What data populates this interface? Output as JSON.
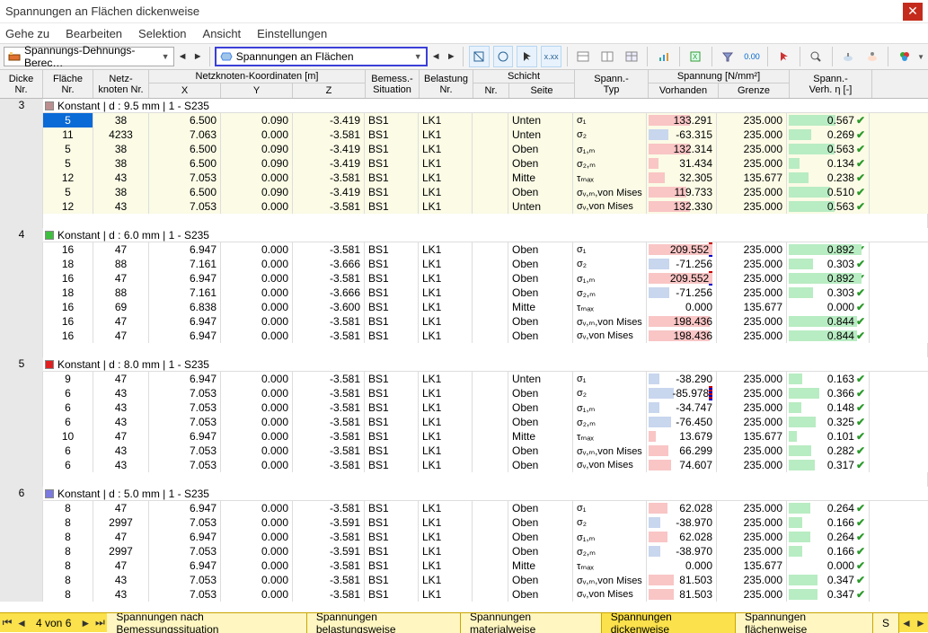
{
  "window": {
    "title": "Spannungen an Flächen dickenweise"
  },
  "menu": [
    "Gehe zu",
    "Bearbeiten",
    "Selektion",
    "Ansicht",
    "Einstellungen"
  ],
  "toolbar": {
    "left_dropdown": "Spannungs-Dehnungs-Berec…",
    "main_dropdown": "Spannungen an Flächen"
  },
  "columns": {
    "dicke": "Dicke\nNr.",
    "flaeche": "Fläche\nNr.",
    "netzknoten": "Netz-\nknoten Nr.",
    "koord_group": "Netzknoten-Koordinaten [m]",
    "x": "X",
    "y": "Y",
    "z": "Z",
    "bemess": "Bemess.-\nSituation",
    "belastung": "Belastung\nNr.",
    "schicht_group": "Schicht",
    "schicht_nr": "Nr.",
    "seite": "Seite",
    "spanntyp": "Spann.-\nTyp",
    "spannung_group": "Spannung [N/mm²]",
    "vorhanden": "Vorhanden",
    "grenze": "Grenze",
    "spannverh": "Spann.-\nVerh. η [-]"
  },
  "groups": [
    {
      "dicke": "3",
      "swatch": "#bb8f8f",
      "label": "Konstant | d : 9.5 mm | 1 - S235",
      "shade": "pale",
      "rows": [
        {
          "fl": "5",
          "sel": true,
          "nk": "38",
          "x": "6.500",
          "y": "0.090",
          "z": "-3.419",
          "bs": "BS1",
          "bl": "LK1",
          "sn": "",
          "st": "Unten",
          "typ": "σ₁",
          "vor": "133.291",
          "vorbar": 60,
          "vorcolor": "red",
          "gr": "235.000",
          "vh": "0.567"
        },
        {
          "fl": "11",
          "nk": "4233",
          "x": "7.063",
          "y": "0.000",
          "z": "-3.581",
          "bs": "BS1",
          "bl": "LK1",
          "sn": "",
          "st": "Unten",
          "typ": "σ₂",
          "vor": "-63.315",
          "vorbar": 28,
          "vorcolor": "blue",
          "gr": "235.000",
          "vh": "0.269"
        },
        {
          "fl": "5",
          "nk": "38",
          "x": "6.500",
          "y": "0.090",
          "z": "-3.419",
          "bs": "BS1",
          "bl": "LK1",
          "sn": "",
          "st": "Oben",
          "typ": "σ₁,ₘ",
          "vor": "132.314",
          "vorbar": 60,
          "vorcolor": "red",
          "gr": "235.000",
          "vh": "0.563"
        },
        {
          "fl": "5",
          "nk": "38",
          "x": "6.500",
          "y": "0.090",
          "z": "-3.419",
          "bs": "BS1",
          "bl": "LK1",
          "sn": "",
          "st": "Oben",
          "typ": "σ₂,ₘ",
          "vor": "31.434",
          "vorbar": 14,
          "vorcolor": "red",
          "gr": "235.000",
          "vh": "0.134"
        },
        {
          "fl": "12",
          "nk": "43",
          "x": "7.053",
          "y": "0.000",
          "z": "-3.581",
          "bs": "BS1",
          "bl": "LK1",
          "sn": "",
          "st": "Mitte",
          "typ": "τₘₐₓ",
          "vor": "32.305",
          "vorbar": 24,
          "vorcolor": "red",
          "gr": "135.677",
          "vh": "0.238"
        },
        {
          "fl": "5",
          "nk": "38",
          "x": "6.500",
          "y": "0.090",
          "z": "-3.419",
          "bs": "BS1",
          "bl": "LK1",
          "sn": "",
          "st": "Oben",
          "typ": "σᵥ,ₘ,von Mises",
          "vor": "119.733",
          "vorbar": 54,
          "vorcolor": "red",
          "gr": "235.000",
          "vh": "0.510"
        },
        {
          "fl": "12",
          "nk": "43",
          "x": "7.053",
          "y": "0.000",
          "z": "-3.581",
          "bs": "BS1",
          "bl": "LK1",
          "sn": "",
          "st": "Unten",
          "typ": "σᵥ,von Mises",
          "vor": "132.330",
          "vorbar": 60,
          "vorcolor": "red",
          "gr": "235.000",
          "vh": "0.563"
        }
      ]
    },
    {
      "dicke": "4",
      "swatch": "#3fbf3f",
      "label": "Konstant | d : 6.0 mm | 1 - S235",
      "shade": "",
      "rows": [
        {
          "fl": "16",
          "nk": "47",
          "x": "6.947",
          "y": "0.000",
          "z": "-3.581",
          "bs": "BS1",
          "bl": "LK1",
          "sn": "",
          "st": "Oben",
          "typ": "σ₁",
          "vor": "209.552",
          "vorbar": 92,
          "vorcolor": "red",
          "mark": true,
          "gr": "235.000",
          "vh": "0.892"
        },
        {
          "fl": "18",
          "nk": "88",
          "x": "7.161",
          "y": "0.000",
          "z": "-3.666",
          "bs": "BS1",
          "bl": "LK1",
          "sn": "",
          "st": "Oben",
          "typ": "σ₂",
          "vor": "-71.256",
          "vorbar": 30,
          "vorcolor": "blue",
          "gr": "235.000",
          "vh": "0.303"
        },
        {
          "fl": "16",
          "nk": "47",
          "x": "6.947",
          "y": "0.000",
          "z": "-3.581",
          "bs": "BS1",
          "bl": "LK1",
          "sn": "",
          "st": "Oben",
          "typ": "σ₁,ₘ",
          "vor": "209.552",
          "vorbar": 92,
          "vorcolor": "red",
          "mark": true,
          "gr": "235.000",
          "vh": "0.892"
        },
        {
          "fl": "18",
          "nk": "88",
          "x": "7.161",
          "y": "0.000",
          "z": "-3.666",
          "bs": "BS1",
          "bl": "LK1",
          "sn": "",
          "st": "Oben",
          "typ": "σ₂,ₘ",
          "vor": "-71.256",
          "vorbar": 30,
          "vorcolor": "blue",
          "gr": "235.000",
          "vh": "0.303"
        },
        {
          "fl": "16",
          "nk": "69",
          "x": "6.838",
          "y": "0.000",
          "z": "-3.600",
          "bs": "BS1",
          "bl": "LK1",
          "sn": "",
          "st": "Mitte",
          "typ": "τₘₐₓ",
          "vor": "0.000",
          "vorbar": 0,
          "vorcolor": "red",
          "gr": "135.677",
          "vh": "0.000"
        },
        {
          "fl": "16",
          "nk": "47",
          "x": "6.947",
          "y": "0.000",
          "z": "-3.581",
          "bs": "BS1",
          "bl": "LK1",
          "sn": "",
          "st": "Oben",
          "typ": "σᵥ,ₘ,von Mises",
          "vor": "198.436",
          "vorbar": 88,
          "vorcolor": "red",
          "gr": "235.000",
          "vh": "0.844"
        },
        {
          "fl": "16",
          "nk": "47",
          "x": "6.947",
          "y": "0.000",
          "z": "-3.581",
          "bs": "BS1",
          "bl": "LK1",
          "sn": "",
          "st": "Oben",
          "typ": "σᵥ,von Mises",
          "vor": "198.436",
          "vorbar": 88,
          "vorcolor": "red",
          "gr": "235.000",
          "vh": "0.844"
        }
      ]
    },
    {
      "dicke": "5",
      "swatch": "#e02020",
      "label": "Konstant | d : 8.0 mm | 1 - S235",
      "shade": "",
      "rows": [
        {
          "fl": "9",
          "nk": "47",
          "x": "6.947",
          "y": "0.000",
          "z": "-3.581",
          "bs": "BS1",
          "bl": "LK1",
          "sn": "",
          "st": "Unten",
          "typ": "σ₁",
          "vor": "-38.290",
          "vorbar": 16,
          "vorcolor": "blue",
          "gr": "235.000",
          "vh": "0.163"
        },
        {
          "fl": "6",
          "nk": "43",
          "x": "7.053",
          "y": "0.000",
          "z": "-3.581",
          "bs": "BS1",
          "bl": "LK1",
          "sn": "",
          "st": "Oben",
          "typ": "σ₂",
          "vor": "-85.978",
          "vorbar": 37,
          "vorcolor": "blue",
          "mark": true,
          "gr": "235.000",
          "vh": "0.366"
        },
        {
          "fl": "6",
          "nk": "43",
          "x": "7.053",
          "y": "0.000",
          "z": "-3.581",
          "bs": "BS1",
          "bl": "LK1",
          "sn": "",
          "st": "Oben",
          "typ": "σ₁,ₘ",
          "vor": "-34.747",
          "vorbar": 15,
          "vorcolor": "blue",
          "gr": "235.000",
          "vh": "0.148"
        },
        {
          "fl": "6",
          "nk": "43",
          "x": "7.053",
          "y": "0.000",
          "z": "-3.581",
          "bs": "BS1",
          "bl": "LK1",
          "sn": "",
          "st": "Oben",
          "typ": "σ₂,ₘ",
          "vor": "-76.450",
          "vorbar": 33,
          "vorcolor": "blue",
          "gr": "235.000",
          "vh": "0.325"
        },
        {
          "fl": "10",
          "nk": "47",
          "x": "6.947",
          "y": "0.000",
          "z": "-3.581",
          "bs": "BS1",
          "bl": "LK1",
          "sn": "",
          "st": "Mitte",
          "typ": "τₘₐₓ",
          "vor": "13.679",
          "vorbar": 10,
          "vorcolor": "red",
          "gr": "135.677",
          "vh": "0.101"
        },
        {
          "fl": "6",
          "nk": "43",
          "x": "7.053",
          "y": "0.000",
          "z": "-3.581",
          "bs": "BS1",
          "bl": "LK1",
          "sn": "",
          "st": "Oben",
          "typ": "σᵥ,ₘ,von Mises",
          "vor": "66.299",
          "vorbar": 29,
          "vorcolor": "red",
          "gr": "235.000",
          "vh": "0.282"
        },
        {
          "fl": "6",
          "nk": "43",
          "x": "7.053",
          "y": "0.000",
          "z": "-3.581",
          "bs": "BS1",
          "bl": "LK1",
          "sn": "",
          "st": "Oben",
          "typ": "σᵥ,von Mises",
          "vor": "74.607",
          "vorbar": 32,
          "vorcolor": "red",
          "gr": "235.000",
          "vh": "0.317"
        }
      ]
    },
    {
      "dicke": "6",
      "swatch": "#7a7ae0",
      "label": "Konstant | d : 5.0 mm | 1 - S235",
      "shade": "",
      "rows": [
        {
          "fl": "8",
          "nk": "47",
          "x": "6.947",
          "y": "0.000",
          "z": "-3.581",
          "bs": "BS1",
          "bl": "LK1",
          "sn": "",
          "st": "Oben",
          "typ": "σ₁",
          "vor": "62.028",
          "vorbar": 27,
          "vorcolor": "red",
          "gr": "235.000",
          "vh": "0.264"
        },
        {
          "fl": "8",
          "nk": "2997",
          "x": "7.053",
          "y": "0.000",
          "z": "-3.591",
          "bs": "BS1",
          "bl": "LK1",
          "sn": "",
          "st": "Oben",
          "typ": "σ₂",
          "vor": "-38.970",
          "vorbar": 17,
          "vorcolor": "blue",
          "gr": "235.000",
          "vh": "0.166"
        },
        {
          "fl": "8",
          "nk": "47",
          "x": "6.947",
          "y": "0.000",
          "z": "-3.581",
          "bs": "BS1",
          "bl": "LK1",
          "sn": "",
          "st": "Oben",
          "typ": "σ₁,ₘ",
          "vor": "62.028",
          "vorbar": 27,
          "vorcolor": "red",
          "gr": "235.000",
          "vh": "0.264"
        },
        {
          "fl": "8",
          "nk": "2997",
          "x": "7.053",
          "y": "0.000",
          "z": "-3.591",
          "bs": "BS1",
          "bl": "LK1",
          "sn": "",
          "st": "Oben",
          "typ": "σ₂,ₘ",
          "vor": "-38.970",
          "vorbar": 17,
          "vorcolor": "blue",
          "gr": "235.000",
          "vh": "0.166"
        },
        {
          "fl": "8",
          "nk": "47",
          "x": "6.947",
          "y": "0.000",
          "z": "-3.581",
          "bs": "BS1",
          "bl": "LK1",
          "sn": "",
          "st": "Mitte",
          "typ": "τₘₐₓ",
          "vor": "0.000",
          "vorbar": 0,
          "vorcolor": "red",
          "gr": "135.677",
          "vh": "0.000"
        },
        {
          "fl": "8",
          "nk": "43",
          "x": "7.053",
          "y": "0.000",
          "z": "-3.581",
          "bs": "BS1",
          "bl": "LK1",
          "sn": "",
          "st": "Oben",
          "typ": "σᵥ,ₘ,von Mises",
          "vor": "81.503",
          "vorbar": 36,
          "vorcolor": "red",
          "gr": "235.000",
          "vh": "0.347"
        },
        {
          "fl": "8",
          "nk": "43",
          "x": "7.053",
          "y": "0.000",
          "z": "-3.581",
          "bs": "BS1",
          "bl": "LK1",
          "sn": "",
          "st": "Oben",
          "typ": "σᵥ,von Mises",
          "vor": "81.503",
          "vorbar": 36,
          "vorcolor": "red",
          "gr": "235.000",
          "vh": "0.347"
        }
      ]
    }
  ],
  "footer": {
    "page": "4 von 6",
    "tabs": [
      "Spannungen nach Bemessungssituation",
      "Spannungen belastungsweise",
      "Spannungen materialweise",
      "Spannungen dickenweise",
      "Spannungen flächenweise",
      "S"
    ],
    "active": 3
  }
}
